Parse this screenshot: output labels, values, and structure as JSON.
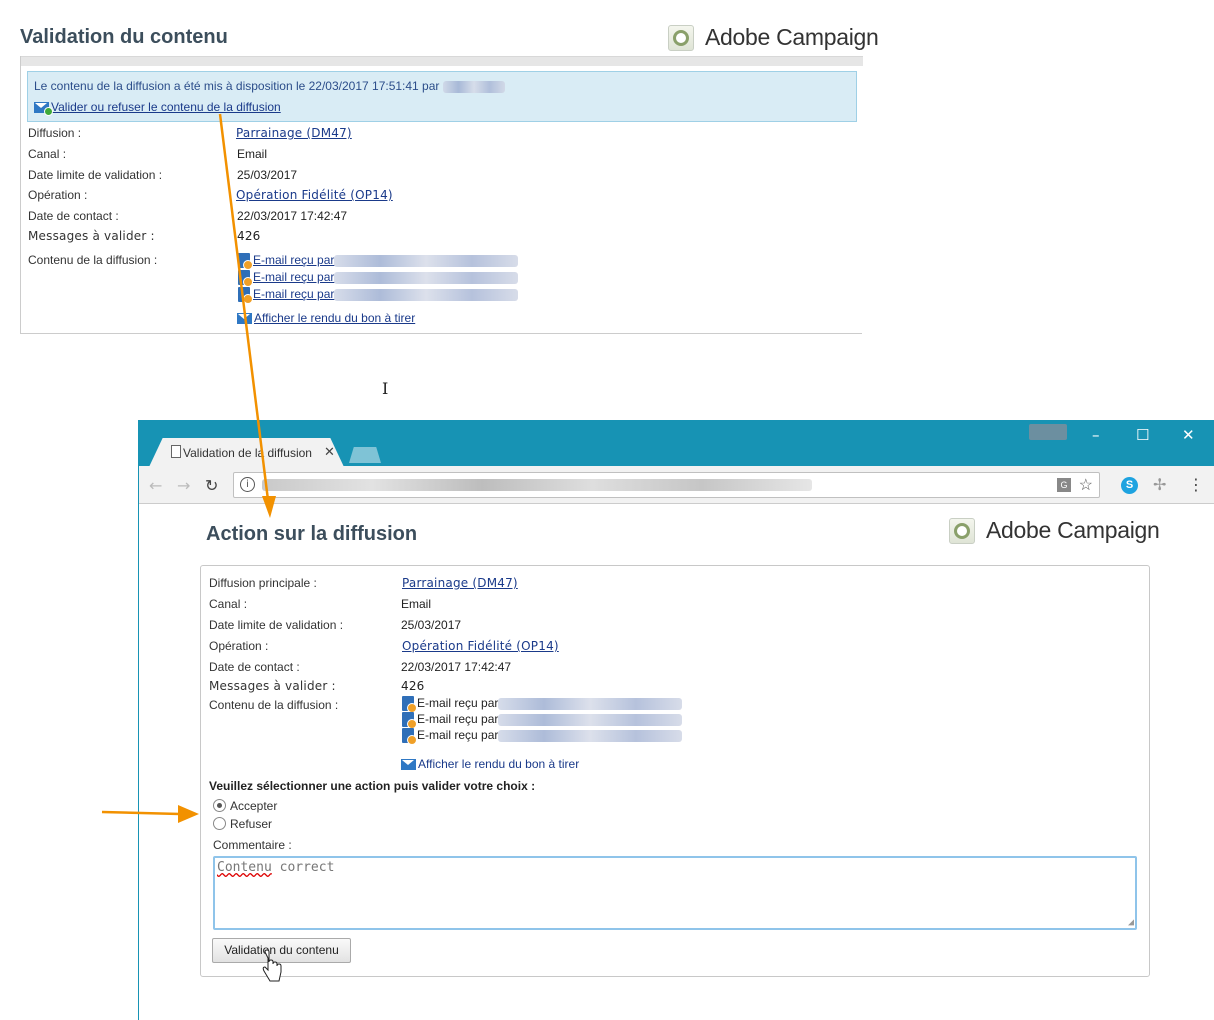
{
  "colors": {
    "arrow": "#F29100",
    "chrome_titlebar": "#1793B4",
    "notice_bg": "#D9ECF5",
    "link": "#1A3A8A"
  },
  "top": {
    "title": "Validation du contenu",
    "brand": "Adobe Campaign",
    "notice": {
      "text": "Le contenu de la diffusion a été mis à disposition le 22/03/2017 17:51:41 par",
      "link": "Valider ou refuser le contenu de la diffusion",
      "icon": "email-check-icon"
    },
    "fields": {
      "diffusion_label": "Diffusion :",
      "diffusion_value": "Parrainage (DM47)",
      "canal_label": "Canal :",
      "canal_value": "Email",
      "date_limite_label": "Date limite de validation :",
      "date_limite_value": "25/03/2017",
      "operation_label": "Opération :",
      "operation_value": "Opération Fidélité (OP14)",
      "date_contact_label": "Date de contact :",
      "date_contact_value": "22/03/2017 17:42:47",
      "messages_label": "Messages à valider :",
      "messages_value": "426",
      "contenu_label": "Contenu de la diffusion :"
    },
    "proofs": [
      "E-mail reçu par",
      "E-mail reçu par",
      "E-mail reçu par"
    ],
    "render_link": "Afficher le rendu du bon à tirer"
  },
  "browser": {
    "tab_title": "Validation de la diffusion",
    "window_controls": [
      "–",
      "☐",
      "✕"
    ]
  },
  "page": {
    "title": "Action sur la diffusion",
    "brand": "Adobe Campaign",
    "fields": {
      "diffusion_label": "Diffusion principale :",
      "diffusion_value": "Parrainage (DM47)",
      "canal_label": "Canal :",
      "canal_value": "Email",
      "date_limite_label": "Date limite de validation :",
      "date_limite_value": "25/03/2017",
      "operation_label": "Opération :",
      "operation_value": "Opération Fidélité (OP14)",
      "date_contact_label": "Date de contact :",
      "date_contact_value": "22/03/2017 17:42:47",
      "messages_label": "Messages à valider :",
      "messages_value": "426",
      "contenu_label": "Contenu de la diffusion :"
    },
    "proofs": [
      "E-mail reçu par",
      "E-mail reçu par",
      "E-mail reçu par"
    ],
    "render_link": "Afficher le rendu du bon à tirer",
    "action_prompt": "Veuillez sélectionner une action puis valider votre choix :",
    "options": [
      {
        "label": "Accepter",
        "selected": true
      },
      {
        "label": "Refuser",
        "selected": false
      }
    ],
    "comment_label": "Commentaire :",
    "comment_word1": "Contenu",
    "comment_word2": " correct",
    "submit_label": "Validation du contenu"
  }
}
